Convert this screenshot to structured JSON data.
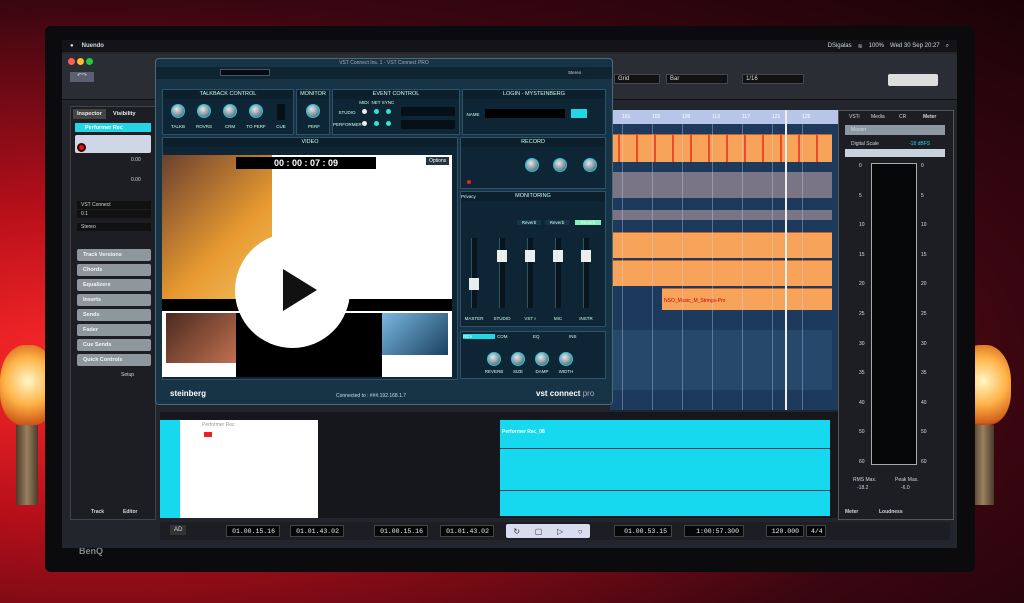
{
  "brand": {
    "monitor": "BenQ"
  },
  "menubar": {
    "app": "Nuendo",
    "user": "DSigalas",
    "datetime": "Wed 30 Sep  20:27",
    "battery": "100%"
  },
  "toolbar": {
    "grid_mode": "Grid",
    "grid_type": "Bar",
    "quantize": "1/16"
  },
  "inspector": {
    "tabs": [
      "Inspector",
      "Visibility"
    ],
    "track_name": "Performer Rec",
    "volume": "0.00",
    "pan": "0.00",
    "input": "VST Connect",
    "output": "0.1",
    "routing": "Stereo",
    "sections": [
      "Track Versions",
      "Chords",
      "Equalizers",
      "Inserts",
      "Sends",
      "Fader",
      "Cue Sends",
      "Quick Controls"
    ],
    "setup": "Setup",
    "bottom_tabs": [
      "Track",
      "Editor"
    ]
  },
  "arrangement": {
    "ruler": [
      "101",
      "105",
      "109",
      "113",
      "117",
      "121",
      "125"
    ],
    "clip_label": "NSO_Music_M_Strings-Pro"
  },
  "right_zone": {
    "tabs": [
      "VSTi",
      "Media",
      "CR",
      "Meter"
    ],
    "output": "Master",
    "digital_scale_label": "Digital Scale",
    "digital_scale_value": "-18 dBFS",
    "scale": [
      "0",
      "5",
      "10",
      "15",
      "20",
      "25",
      "30",
      "35",
      "40",
      "50",
      "60"
    ],
    "rms_label": "RMS Max.",
    "rms_value": "-18.2",
    "peak_label": "Peak Max.",
    "peak_value": "-6.0",
    "bottom_tabs": [
      "Meter",
      "Loudness"
    ]
  },
  "vst_connect": {
    "title": "VST Connect Ins. 1 - VST Connect PRO",
    "preset": "Stereo",
    "talkback": {
      "title": "TALKBACK CONTROL",
      "knobs": [
        "TALKB",
        "ROVRS",
        "CRM",
        "TO PERF",
        "CUE"
      ]
    },
    "monitor": {
      "title": "MONITOR",
      "knob": "PERF"
    },
    "event": {
      "title": "EVENT CONTROL",
      "cols": [
        "MIDI",
        "NET",
        "SYNC"
      ],
      "rows": [
        "STUDIO",
        "PERFORMER"
      ]
    },
    "login": {
      "title": "LOGIN - MYSTEINBERG",
      "name_label": "NAME"
    },
    "video": {
      "title": "VIDEO",
      "timecode": "00 : 00 : 07 : 09",
      "options": "Options"
    },
    "record": {
      "title": "RECORD"
    },
    "monitoring": {
      "title": "MONITORING",
      "privacy": "Privacy",
      "reverb": "Reverb",
      "channels": [
        "MASTER",
        "STUDIO",
        "VST I",
        "MIC",
        "INSTR"
      ]
    },
    "fx_tabs": [
      "REV",
      "COM",
      "EQ",
      "INS"
    ],
    "fx_knobs": [
      "REVERB",
      "SIZE",
      "DAMP",
      "WIDTH"
    ],
    "logo": "steinberg",
    "status": "Connected to : ###.192.168.1.7",
    "product": "vst connect",
    "product_suffix": "pro"
  },
  "editor": {
    "header": "Performer Rec",
    "event_label": "Performer Rec_08"
  },
  "transport": {
    "left_locator": "01.00.15.16",
    "right_locator": "01.01.43.02",
    "punch_in": "01.00.15.16",
    "punch_out": "01.01.43.02",
    "position_bars": "01.00.53.15",
    "position_time": "1:00:57.300",
    "tempo": "120.000",
    "signature": "4/4",
    "ad_label": "AD"
  },
  "colors": {
    "accent": "#22d6e6",
    "clip": "#f8a35a",
    "waveform": "#e8201a",
    "editor_bg": "#16d8ee"
  }
}
